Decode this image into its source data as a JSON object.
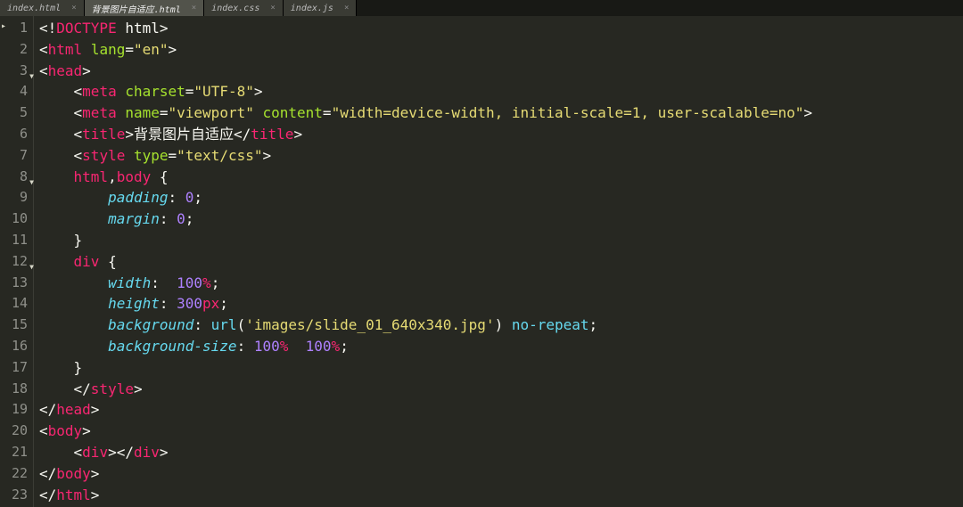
{
  "tabs": [
    {
      "label": "index.html",
      "active": false
    },
    {
      "label": "背景图片自适应.html",
      "active": true
    },
    {
      "label": "index.css",
      "active": false
    },
    {
      "label": "index.js",
      "active": false
    }
  ],
  "code": {
    "lines": [
      {
        "num": "1",
        "fold": "",
        "indent": "",
        "tokens": [
          {
            "t": "<!",
            "c": "punc"
          },
          {
            "t": "DOCTYPE",
            "c": "kw"
          },
          {
            "t": " html",
            "c": "text"
          },
          {
            "t": ">",
            "c": "punc"
          }
        ]
      },
      {
        "num": "2",
        "fold": "",
        "indent": "",
        "tokens": [
          {
            "t": "<",
            "c": "punc"
          },
          {
            "t": "html",
            "c": "kw"
          },
          {
            "t": " ",
            "c": "text"
          },
          {
            "t": "lang",
            "c": "attr"
          },
          {
            "t": "=",
            "c": "punc"
          },
          {
            "t": "\"en\"",
            "c": "string"
          },
          {
            "t": ">",
            "c": "punc"
          }
        ]
      },
      {
        "num": "3",
        "fold": "▼",
        "indent": "",
        "tokens": [
          {
            "t": "<",
            "c": "punc"
          },
          {
            "t": "head",
            "c": "kw"
          },
          {
            "t": ">",
            "c": "punc"
          }
        ]
      },
      {
        "num": "4",
        "fold": "",
        "indent": "    ",
        "tokens": [
          {
            "t": "<",
            "c": "punc"
          },
          {
            "t": "meta",
            "c": "kw"
          },
          {
            "t": " ",
            "c": "text"
          },
          {
            "t": "charset",
            "c": "attr"
          },
          {
            "t": "=",
            "c": "punc"
          },
          {
            "t": "\"UTF-8\"",
            "c": "string"
          },
          {
            "t": ">",
            "c": "punc"
          }
        ]
      },
      {
        "num": "5",
        "fold": "",
        "indent": "    ",
        "tokens": [
          {
            "t": "<",
            "c": "punc"
          },
          {
            "t": "meta",
            "c": "kw"
          },
          {
            "t": " ",
            "c": "text"
          },
          {
            "t": "name",
            "c": "attr"
          },
          {
            "t": "=",
            "c": "punc"
          },
          {
            "t": "\"viewport\"",
            "c": "string"
          },
          {
            "t": " ",
            "c": "text"
          },
          {
            "t": "content",
            "c": "attr"
          },
          {
            "t": "=",
            "c": "punc"
          },
          {
            "t": "\"width=device-width, initial-scale=1, user-scalable=no\"",
            "c": "string"
          },
          {
            "t": ">",
            "c": "punc"
          }
        ]
      },
      {
        "num": "6",
        "fold": "",
        "indent": "    ",
        "tokens": [
          {
            "t": "<",
            "c": "punc"
          },
          {
            "t": "title",
            "c": "kw"
          },
          {
            "t": ">",
            "c": "punc"
          },
          {
            "t": "背景图片自适应",
            "c": "text"
          },
          {
            "t": "</",
            "c": "punc"
          },
          {
            "t": "title",
            "c": "kw"
          },
          {
            "t": ">",
            "c": "punc"
          }
        ]
      },
      {
        "num": "7",
        "fold": "",
        "indent": "    ",
        "tokens": [
          {
            "t": "<",
            "c": "punc"
          },
          {
            "t": "style",
            "c": "kw"
          },
          {
            "t": " ",
            "c": "text"
          },
          {
            "t": "type",
            "c": "attr"
          },
          {
            "t": "=",
            "c": "punc"
          },
          {
            "t": "\"text/css\"",
            "c": "string"
          },
          {
            "t": ">",
            "c": "punc"
          }
        ]
      },
      {
        "num": "8",
        "fold": "▼",
        "indent": "    ",
        "tokens": [
          {
            "t": "html",
            "c": "sel"
          },
          {
            "t": ",",
            "c": "punc"
          },
          {
            "t": "body",
            "c": "sel"
          },
          {
            "t": " {",
            "c": "punc"
          }
        ]
      },
      {
        "num": "9",
        "fold": "",
        "indent": "        ",
        "tokens": [
          {
            "t": "padding",
            "c": "prop"
          },
          {
            "t": ": ",
            "c": "punc"
          },
          {
            "t": "0",
            "c": "val"
          },
          {
            "t": ";",
            "c": "punc"
          }
        ]
      },
      {
        "num": "10",
        "fold": "",
        "indent": "        ",
        "tokens": [
          {
            "t": "margin",
            "c": "prop"
          },
          {
            "t": ": ",
            "c": "punc"
          },
          {
            "t": "0",
            "c": "val"
          },
          {
            "t": ";",
            "c": "punc"
          }
        ]
      },
      {
        "num": "11",
        "fold": "",
        "indent": "    ",
        "tokens": [
          {
            "t": "}",
            "c": "punc"
          }
        ]
      },
      {
        "num": "12",
        "fold": "▼",
        "indent": "    ",
        "tokens": [
          {
            "t": "div",
            "c": "sel"
          },
          {
            "t": " {",
            "c": "punc"
          }
        ]
      },
      {
        "num": "13",
        "fold": "",
        "indent": "        ",
        "tokens": [
          {
            "t": "width",
            "c": "prop"
          },
          {
            "t": ":  ",
            "c": "punc"
          },
          {
            "t": "100",
            "c": "val"
          },
          {
            "t": "%",
            "c": "sel"
          },
          {
            "t": ";",
            "c": "punc"
          }
        ]
      },
      {
        "num": "14",
        "fold": "",
        "indent": "        ",
        "tokens": [
          {
            "t": "height",
            "c": "prop"
          },
          {
            "t": ": ",
            "c": "punc"
          },
          {
            "t": "300",
            "c": "val"
          },
          {
            "t": "px",
            "c": "sel"
          },
          {
            "t": ";",
            "c": "punc"
          }
        ]
      },
      {
        "num": "15",
        "fold": "",
        "indent": "        ",
        "tokens": [
          {
            "t": "background",
            "c": "prop"
          },
          {
            "t": ": ",
            "c": "punc"
          },
          {
            "t": "url",
            "c": "func"
          },
          {
            "t": "(",
            "c": "punc"
          },
          {
            "t": "'images/slide_01_640x340.jpg'",
            "c": "string"
          },
          {
            "t": ") ",
            "c": "punc"
          },
          {
            "t": "no-repeat",
            "c": "valkw"
          },
          {
            "t": ";",
            "c": "punc"
          }
        ]
      },
      {
        "num": "16",
        "fold": "",
        "indent": "        ",
        "tokens": [
          {
            "t": "background-size",
            "c": "prop"
          },
          {
            "t": ": ",
            "c": "punc"
          },
          {
            "t": "100",
            "c": "val"
          },
          {
            "t": "%",
            "c": "sel"
          },
          {
            "t": "  ",
            "c": "punc"
          },
          {
            "t": "100",
            "c": "val"
          },
          {
            "t": "%",
            "c": "sel"
          },
          {
            "t": ";",
            "c": "punc"
          }
        ]
      },
      {
        "num": "17",
        "fold": "",
        "indent": "    ",
        "tokens": [
          {
            "t": "}",
            "c": "punc"
          }
        ]
      },
      {
        "num": "18",
        "fold": "",
        "indent": "    ",
        "tokens": [
          {
            "t": "</",
            "c": "punc"
          },
          {
            "t": "style",
            "c": "kw"
          },
          {
            "t": ">",
            "c": "punc"
          }
        ]
      },
      {
        "num": "19",
        "fold": "",
        "indent": "",
        "tokens": [
          {
            "t": "</",
            "c": "punc"
          },
          {
            "t": "head",
            "c": "kw"
          },
          {
            "t": ">",
            "c": "punc"
          }
        ]
      },
      {
        "num": "20",
        "fold": "",
        "indent": "",
        "tokens": [
          {
            "t": "<",
            "c": "punc"
          },
          {
            "t": "body",
            "c": "kw"
          },
          {
            "t": ">",
            "c": "punc"
          }
        ]
      },
      {
        "num": "21",
        "fold": "",
        "indent": "    ",
        "tokens": [
          {
            "t": "<",
            "c": "punc"
          },
          {
            "t": "div",
            "c": "kw"
          },
          {
            "t": "></",
            "c": "punc"
          },
          {
            "t": "div",
            "c": "kw"
          },
          {
            "t": ">",
            "c": "punc"
          }
        ]
      },
      {
        "num": "22",
        "fold": "",
        "indent": "",
        "tokens": [
          {
            "t": "</",
            "c": "punc"
          },
          {
            "t": "body",
            "c": "kw"
          },
          {
            "t": ">",
            "c": "punc"
          }
        ]
      },
      {
        "num": "23",
        "fold": "",
        "indent": "",
        "tokens": [
          {
            "t": "</",
            "c": "punc"
          },
          {
            "t": "html",
            "c": "kw"
          },
          {
            "t": ">",
            "c": "punc"
          }
        ]
      }
    ]
  }
}
